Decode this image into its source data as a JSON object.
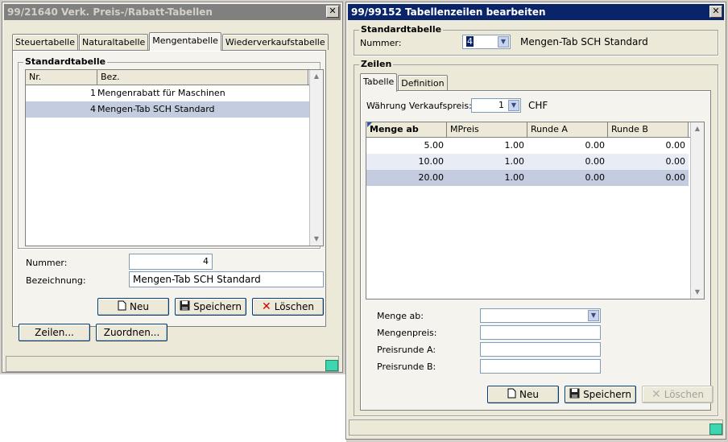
{
  "left_window": {
    "title": "99/21640 Verk. Preis-/Rabatt-Tabellen",
    "tabs": [
      "Steuertabelle",
      "Naturaltabelle",
      "Mengentabelle",
      "Wiederverkaufstabelle"
    ],
    "active_tab": "Mengentabelle",
    "group_title": "Standardtabelle",
    "columns": [
      "Nr.",
      "Bez."
    ],
    "rows": [
      {
        "nr": "1",
        "bez": "Mengenrabatt für Maschinen"
      },
      {
        "nr": "4",
        "bez": "Mengen-Tab SCH Standard"
      }
    ],
    "nummer_label": "Nummer:",
    "nummer_value": "4",
    "bezeichnung_label": "Bezeichnung:",
    "bezeichnung_value": "Mengen-Tab SCH Standard",
    "btn_neu": "Neu",
    "btn_speichern": "Speichern",
    "btn_loeschen": "Löschen",
    "btn_zeilen": "Zeilen...",
    "btn_zuordnen": "Zuordnen..."
  },
  "right_window": {
    "title": "99/99152 Tabellenzeilen bearbeiten",
    "group_standard": "Standardtabelle",
    "nummer_label": "Nummer:",
    "nummer_value": "4",
    "nummer_desc": "Mengen-Tab SCH Standard",
    "group_zeilen": "Zeilen",
    "tabs": [
      "Tabelle",
      "Definition"
    ],
    "active_tab": "Tabelle",
    "waehrung_label": "Währung Verkaufspreis:",
    "waehrung_value": "1",
    "waehrung_code": "CHF",
    "columns": [
      "Menge ab",
      "MPreis",
      "Runde A",
      "Runde B"
    ],
    "rows": [
      [
        "5.00",
        "1.00",
        "0.00",
        "0.00"
      ],
      [
        "10.00",
        "1.00",
        "0.00",
        "0.00"
      ],
      [
        "20.00",
        "1.00",
        "0.00",
        "0.00"
      ]
    ],
    "menge_ab_label": "Menge ab:",
    "mengenpreis_label": "Mengenpreis:",
    "preisrunde_a_label": "Preisrunde A:",
    "preisrunde_b_label": "Preisrunde B:",
    "btn_neu": "Neu",
    "btn_speichern": "Speichern",
    "btn_loeschen": "Löschen"
  },
  "colors": {
    "title_active": "#0a246a",
    "title_inactive": "#808080",
    "selected_row": "#c4cde0",
    "grip": "#3ed6b0"
  }
}
